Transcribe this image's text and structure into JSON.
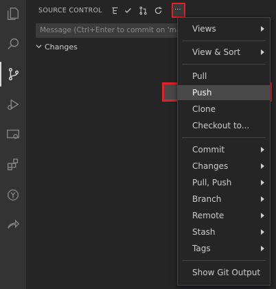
{
  "sidebar": {
    "title": "SOURCE CONTROL",
    "commit_placeholder": "Message (Ctrl+Enter to commit on 'ma",
    "changes_label": "Changes"
  },
  "activity_bar": [
    {
      "name": "explorer-icon"
    },
    {
      "name": "search-icon"
    },
    {
      "name": "source-control-icon",
      "active": true
    },
    {
      "name": "run-debug-icon"
    },
    {
      "name": "remote-explorer-icon"
    },
    {
      "name": "extensions-icon"
    },
    {
      "name": "git-graph-icon"
    },
    {
      "name": "share-icon"
    }
  ],
  "toolbar": [
    {
      "name": "tree-view-icon"
    },
    {
      "name": "check-icon"
    },
    {
      "name": "pull-request-icon"
    },
    {
      "name": "refresh-icon"
    },
    {
      "name": "more-actions-icon",
      "highlighted": true
    }
  ],
  "menu": {
    "items": [
      {
        "label": "Views",
        "submenu": true
      },
      {
        "label": "View & Sort",
        "submenu": true
      },
      {
        "label": "Pull",
        "submenu": false
      },
      {
        "label": "Push",
        "submenu": false,
        "highlighted": true
      },
      {
        "label": "Clone",
        "submenu": false
      },
      {
        "label": "Checkout to...",
        "submenu": false
      },
      {
        "label": "Commit",
        "submenu": true
      },
      {
        "label": "Changes",
        "submenu": true
      },
      {
        "label": "Pull, Push",
        "submenu": true
      },
      {
        "label": "Branch",
        "submenu": true
      },
      {
        "label": "Remote",
        "submenu": true
      },
      {
        "label": "Stash",
        "submenu": true
      },
      {
        "label": "Tags",
        "submenu": true
      },
      {
        "label": "Show Git Output",
        "submenu": false
      }
    ]
  },
  "colors": {
    "highlight_border": "#e0202a",
    "menu_bg": "#252526",
    "text": "#cccccc"
  }
}
